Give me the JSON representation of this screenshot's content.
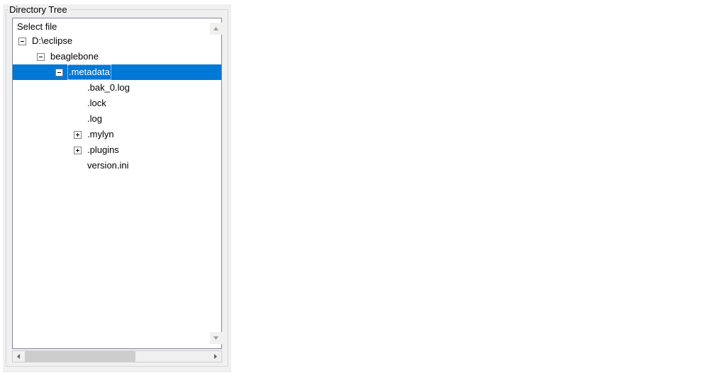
{
  "group": {
    "title": "Directory Tree"
  },
  "tree": {
    "header": "Select file",
    "nodes": [
      {
        "label": "D:\\eclipse",
        "indent": 0,
        "expander": "minus",
        "selected": false
      },
      {
        "label": "beaglebone",
        "indent": 1,
        "expander": "minus",
        "selected": false
      },
      {
        "label": ".metadata",
        "indent": 2,
        "expander": "minus",
        "selected": true
      },
      {
        "label": ".bak_0.log",
        "indent": 3,
        "expander": "none",
        "selected": false
      },
      {
        "label": ".lock",
        "indent": 3,
        "expander": "none",
        "selected": false
      },
      {
        "label": ".log",
        "indent": 3,
        "expander": "none",
        "selected": false
      },
      {
        "label": ".mylyn",
        "indent": 3,
        "expander": "plus",
        "selected": false
      },
      {
        "label": ".plugins",
        "indent": 3,
        "expander": "plus",
        "selected": false
      },
      {
        "label": "version.ini",
        "indent": 3,
        "expander": "none",
        "selected": false
      }
    ]
  }
}
